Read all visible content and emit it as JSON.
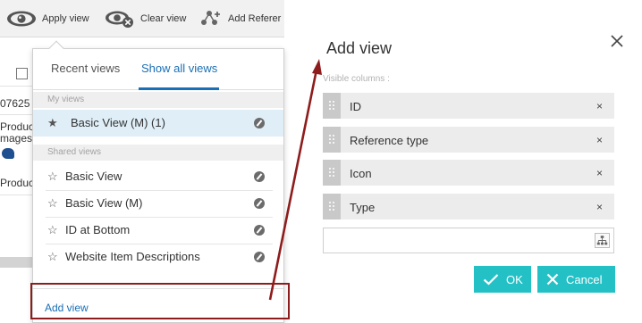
{
  "toolbar": {
    "apply_view": "Apply view",
    "clear_view": "Clear view",
    "add_reference": "Add Referer"
  },
  "background": {
    "row1_text": "07625",
    "row2_text": "Produc",
    "row2b_text": "mages",
    "row3_text": "Produc"
  },
  "views_panel": {
    "tabs": [
      {
        "label": "Recent views"
      },
      {
        "label": "Show all views",
        "active": true
      }
    ],
    "my_views_header": "My views",
    "my_views": [
      {
        "label": "Basic View (M) (1)",
        "selected": true,
        "starred": true
      }
    ],
    "shared_views_header": "Shared views",
    "shared_views": [
      {
        "label": "Basic View"
      },
      {
        "label": "Basic View (M)"
      },
      {
        "label": "ID at Bottom"
      },
      {
        "label": "Website Item Descriptions"
      }
    ],
    "add_view_link": "Add view"
  },
  "dialog": {
    "title": "Add view",
    "visible_columns_label": "Visible columns :",
    "columns": [
      {
        "name": "ID"
      },
      {
        "name": "Reference type"
      },
      {
        "name": "Icon"
      },
      {
        "name": "Type"
      }
    ],
    "remove_glyph": "×",
    "add_column_value": "",
    "ok_label": "OK",
    "cancel_label": "Cancel"
  },
  "colors": {
    "accent_blue": "#1a6fb6",
    "button_teal": "#23c1c6",
    "callout_red": "#8e1c1c",
    "selected_row": "#dfeef7"
  },
  "icons": {
    "apply_view": "eye-icon",
    "clear_view": "eye-clear-icon",
    "add_reference": "add-reference-icon",
    "star": "star-icon",
    "edit": "pencil-circle-icon",
    "drag": "drag-handle-icon",
    "tree": "hierarchy-icon",
    "ok": "check-icon",
    "cancel": "x-icon",
    "close": "close-icon"
  }
}
